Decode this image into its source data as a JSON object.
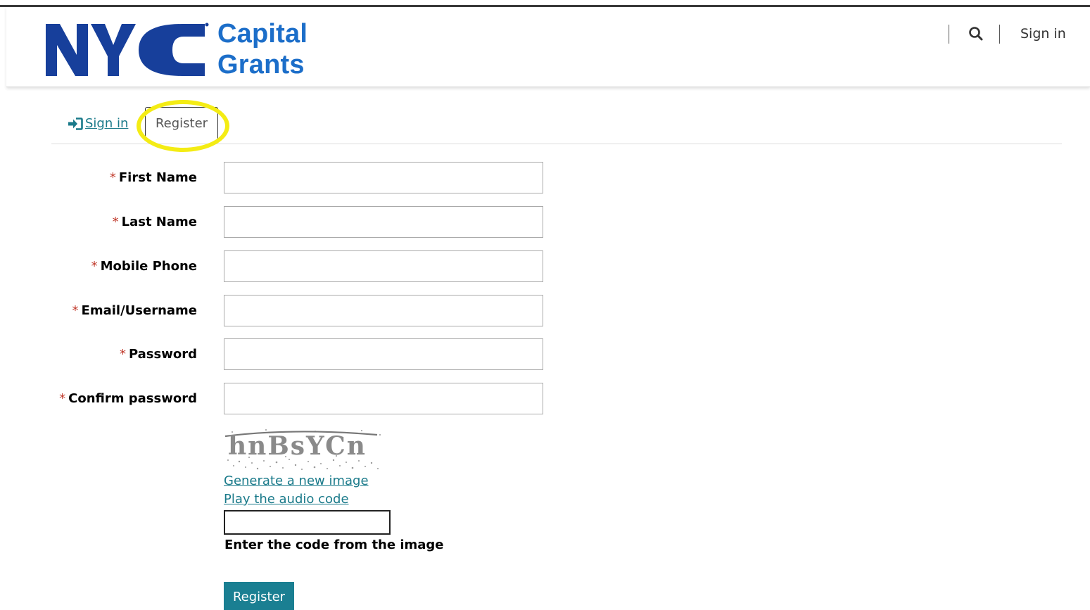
{
  "brand": {
    "logo_mark": "NYC",
    "line1": "Capital",
    "line2": "Grants",
    "color": "#1c6ec9",
    "mark_color": "#173f9b"
  },
  "header": {
    "search_icon": "search-icon",
    "signin_label": "Sign in"
  },
  "tabs": {
    "signin_label": "Sign in",
    "signin_icon": "sign-in-arrow-icon",
    "register_label": "Register",
    "highlight_color": "#f4ec14"
  },
  "form": {
    "required_mark": "*",
    "fields": [
      {
        "label": "First Name",
        "value": ""
      },
      {
        "label": "Last Name",
        "value": ""
      },
      {
        "label": "Mobile Phone",
        "value": ""
      },
      {
        "label": "Email/Username",
        "value": ""
      },
      {
        "label": "Password",
        "value": ""
      },
      {
        "label": "Confirm password",
        "value": ""
      }
    ]
  },
  "captcha": {
    "image_text": "hnBsYCn",
    "generate_link": "Generate a new image",
    "audio_link": "Play the audio code",
    "input_value": "",
    "instruction": "Enter the code from the image"
  },
  "submit_label": "Register",
  "colors": {
    "link": "#1a7a8a",
    "button": "#1a7f92",
    "required": "#c0392b"
  }
}
